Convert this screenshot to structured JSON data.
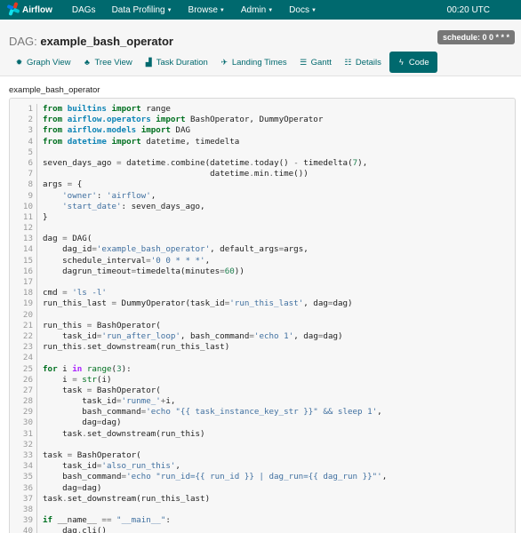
{
  "navbar": {
    "brand": "Airflow",
    "menu": [
      {
        "label": "DAGs",
        "dropdown": false
      },
      {
        "label": "Data Profiling",
        "dropdown": true
      },
      {
        "label": "Browse",
        "dropdown": true
      },
      {
        "label": "Admin",
        "dropdown": true
      },
      {
        "label": "Docs",
        "dropdown": true
      }
    ],
    "time": "00:20 UTC",
    "background_color": "#00696e"
  },
  "header": {
    "title_prefix": "DAG:",
    "dag_name": "example_bash_operator",
    "schedule_badge": "schedule: 0 0 * * *"
  },
  "tabs": [
    {
      "label": "Graph View",
      "icon": "graph-icon",
      "active": false
    },
    {
      "label": "Tree View",
      "icon": "tree-icon",
      "active": false
    },
    {
      "label": "Task Duration",
      "icon": "chart-icon",
      "active": false
    },
    {
      "label": "Landing Times",
      "icon": "plane-icon",
      "active": false
    },
    {
      "label": "Gantt",
      "icon": "gantt-icon",
      "active": false
    },
    {
      "label": "Details",
      "icon": "list-icon",
      "active": false
    },
    {
      "label": "Code",
      "icon": "bolt-icon",
      "active": true
    }
  ],
  "main": {
    "filename": "example_bash_operator"
  },
  "code": {
    "lines": [
      [
        [
          "kw",
          "from"
        ],
        [
          "t",
          " "
        ],
        [
          "ns",
          "builtins"
        ],
        [
          "t",
          " "
        ],
        [
          "kw",
          "import"
        ],
        [
          "t",
          " range"
        ]
      ],
      [
        [
          "kw",
          "from"
        ],
        [
          "t",
          " "
        ],
        [
          "ns",
          "airflow.operators"
        ],
        [
          "t",
          " "
        ],
        [
          "kw",
          "import"
        ],
        [
          "t",
          " BashOperator, DummyOperator"
        ]
      ],
      [
        [
          "kw",
          "from"
        ],
        [
          "t",
          " "
        ],
        [
          "ns",
          "airflow.models"
        ],
        [
          "t",
          " "
        ],
        [
          "kw",
          "import"
        ],
        [
          "t",
          " DAG"
        ]
      ],
      [
        [
          "kw",
          "from"
        ],
        [
          "t",
          " "
        ],
        [
          "ns",
          "datetime"
        ],
        [
          "t",
          " "
        ],
        [
          "kw",
          "import"
        ],
        [
          "t",
          " datetime, timedelta"
        ]
      ],
      [
        [
          "t",
          ""
        ]
      ],
      [
        [
          "t",
          "seven_days_ago "
        ],
        [
          "op",
          "="
        ],
        [
          "t",
          " datetime"
        ],
        [
          "op",
          "."
        ],
        [
          "t",
          "combine(datetime"
        ],
        [
          "op",
          "."
        ],
        [
          "t",
          "today() "
        ],
        [
          "op",
          "-"
        ],
        [
          "t",
          " timedelta("
        ],
        [
          "nm",
          "7"
        ],
        [
          "t",
          "),"
        ]
      ],
      [
        [
          "t",
          "                                  datetime"
        ],
        [
          "op",
          "."
        ],
        [
          "t",
          "min"
        ],
        [
          "op",
          "."
        ],
        [
          "t",
          "time())"
        ]
      ],
      [
        [
          "t",
          "args "
        ],
        [
          "op",
          "="
        ],
        [
          "t",
          " {"
        ]
      ],
      [
        [
          "t",
          "    "
        ],
        [
          "st",
          "'owner'"
        ],
        [
          "t",
          ": "
        ],
        [
          "st",
          "'airflow'"
        ],
        [
          "t",
          ","
        ]
      ],
      [
        [
          "t",
          "    "
        ],
        [
          "st",
          "'start_date'"
        ],
        [
          "t",
          ": seven_days_ago,"
        ]
      ],
      [
        [
          "t",
          "}"
        ]
      ],
      [
        [
          "t",
          ""
        ]
      ],
      [
        [
          "t",
          "dag "
        ],
        [
          "op",
          "="
        ],
        [
          "t",
          " DAG("
        ]
      ],
      [
        [
          "t",
          "    dag_id"
        ],
        [
          "op",
          "="
        ],
        [
          "st",
          "'example_bash_operator'"
        ],
        [
          "t",
          ", default_args"
        ],
        [
          "op",
          "="
        ],
        [
          "t",
          "args,"
        ]
      ],
      [
        [
          "t",
          "    schedule_interval"
        ],
        [
          "op",
          "="
        ],
        [
          "st",
          "'0 0 * * *'"
        ],
        [
          "t",
          ","
        ]
      ],
      [
        [
          "t",
          "    dagrun_timeout"
        ],
        [
          "op",
          "="
        ],
        [
          "t",
          "timedelta(minutes"
        ],
        [
          "op",
          "="
        ],
        [
          "nm",
          "60"
        ],
        [
          "t",
          "))"
        ]
      ],
      [
        [
          "t",
          ""
        ]
      ],
      [
        [
          "t",
          "cmd "
        ],
        [
          "op",
          "="
        ],
        [
          "t",
          " "
        ],
        [
          "st",
          "'ls -l'"
        ]
      ],
      [
        [
          "t",
          "run_this_last "
        ],
        [
          "op",
          "="
        ],
        [
          "t",
          " DummyOperator(task_id"
        ],
        [
          "op",
          "="
        ],
        [
          "st",
          "'run_this_last'"
        ],
        [
          "t",
          ", dag"
        ],
        [
          "op",
          "="
        ],
        [
          "t",
          "dag)"
        ]
      ],
      [
        [
          "t",
          ""
        ]
      ],
      [
        [
          "t",
          "run_this "
        ],
        [
          "op",
          "="
        ],
        [
          "t",
          " BashOperator("
        ]
      ],
      [
        [
          "t",
          "    task_id"
        ],
        [
          "op",
          "="
        ],
        [
          "st",
          "'run_after_loop'"
        ],
        [
          "t",
          ", bash_command"
        ],
        [
          "op",
          "="
        ],
        [
          "st",
          "'echo 1'"
        ],
        [
          "t",
          ", dag"
        ],
        [
          "op",
          "="
        ],
        [
          "t",
          "dag)"
        ]
      ],
      [
        [
          "t",
          "run_this"
        ],
        [
          "op",
          "."
        ],
        [
          "t",
          "set_downstream(run_this_last)"
        ]
      ],
      [
        [
          "t",
          ""
        ]
      ],
      [
        [
          "kw",
          "for"
        ],
        [
          "t",
          " i "
        ],
        [
          "op-w",
          "in"
        ],
        [
          "t",
          " "
        ],
        [
          "bi",
          "range"
        ],
        [
          "t",
          "("
        ],
        [
          "nm",
          "3"
        ],
        [
          "t",
          "):"
        ]
      ],
      [
        [
          "t",
          "    i "
        ],
        [
          "op",
          "="
        ],
        [
          "t",
          " "
        ],
        [
          "bi",
          "str"
        ],
        [
          "t",
          "(i)"
        ]
      ],
      [
        [
          "t",
          "    task "
        ],
        [
          "op",
          "="
        ],
        [
          "t",
          " BashOperator("
        ]
      ],
      [
        [
          "t",
          "        task_id"
        ],
        [
          "op",
          "="
        ],
        [
          "st",
          "'runme_'"
        ],
        [
          "op",
          "+"
        ],
        [
          "t",
          "i,"
        ]
      ],
      [
        [
          "t",
          "        bash_command"
        ],
        [
          "op",
          "="
        ],
        [
          "st",
          "'echo \"{{ task_instance_key_str }}\" && sleep 1'"
        ],
        [
          "t",
          ","
        ]
      ],
      [
        [
          "t",
          "        dag"
        ],
        [
          "op",
          "="
        ],
        [
          "t",
          "dag)"
        ]
      ],
      [
        [
          "t",
          "    task"
        ],
        [
          "op",
          "."
        ],
        [
          "t",
          "set_downstream(run_this)"
        ]
      ],
      [
        [
          "t",
          ""
        ]
      ],
      [
        [
          "t",
          "task "
        ],
        [
          "op",
          "="
        ],
        [
          "t",
          " BashOperator("
        ]
      ],
      [
        [
          "t",
          "    task_id"
        ],
        [
          "op",
          "="
        ],
        [
          "st",
          "'also_run_this'"
        ],
        [
          "t",
          ","
        ]
      ],
      [
        [
          "t",
          "    bash_command"
        ],
        [
          "op",
          "="
        ],
        [
          "st",
          "'echo \"run_id={{ run_id }} | dag_run={{ dag_run }}\"'"
        ],
        [
          "t",
          ","
        ]
      ],
      [
        [
          "t",
          "    dag"
        ],
        [
          "op",
          "="
        ],
        [
          "t",
          "dag)"
        ]
      ],
      [
        [
          "t",
          "task"
        ],
        [
          "op",
          "."
        ],
        [
          "t",
          "set_downstream(run_this_last)"
        ]
      ],
      [
        [
          "t",
          ""
        ]
      ],
      [
        [
          "kw",
          "if"
        ],
        [
          "t",
          " __name__ "
        ],
        [
          "op",
          "=="
        ],
        [
          "t",
          " "
        ],
        [
          "st",
          "\"__main__\""
        ],
        [
          "t",
          ":"
        ]
      ],
      [
        [
          "t",
          "    dag"
        ],
        [
          "op",
          "."
        ],
        [
          "t",
          "cli()"
        ]
      ]
    ]
  }
}
